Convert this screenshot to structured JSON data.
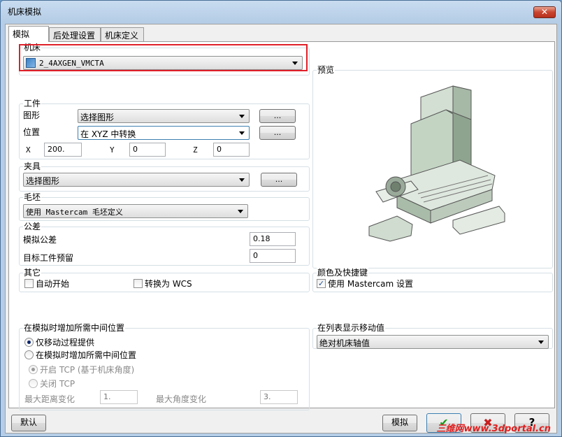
{
  "window": {
    "title": "机床模拟",
    "close_glyph": "✕"
  },
  "tabs": [
    {
      "label": "模拟"
    },
    {
      "label": "后处理设置"
    },
    {
      "label": "机床定义"
    }
  ],
  "machine": {
    "group_label": "机床",
    "value": "2_4AXGEN_VMCTA",
    "icon": "machine-icon"
  },
  "workpiece": {
    "group_label": "工件",
    "geometry_label": "图形",
    "geometry_value": "选择图形",
    "geometry_btn": "...",
    "position_label": "位置",
    "position_value": "在 XYZ 中转换",
    "position_btn": "...",
    "x_label": "X",
    "x_value": "200.",
    "y_label": "Y",
    "y_value": "0",
    "z_label": "Z",
    "z_value": "0"
  },
  "fixture": {
    "group_label": "夹具",
    "value": "选择图形",
    "btn": "..."
  },
  "stock": {
    "group_label": "毛坯",
    "value": "使用 Mastercam 毛坯定义"
  },
  "tolerance": {
    "group_label": "公差",
    "sim_label": "模拟公差",
    "sim_value": "0.18",
    "stock_label": "目标工件预留",
    "stock_value": "0"
  },
  "other": {
    "group_label": "其它",
    "auto_start": "自动开始",
    "convert_wcs": "转换为 WCS"
  },
  "preview": {
    "group_label": "预览"
  },
  "colors": {
    "group_label": "颜色及快捷键",
    "use_mastercam": "使用 Mastercam 设置"
  },
  "intermediate": {
    "group_label": "在模拟时增加所需中间位置",
    "opt1": "仅移动过程提供",
    "opt2": "在模拟时增加所需中间位置",
    "tcp_on": "开启 TCP (基于机床角度)",
    "tcp_off": "关闭 TCP",
    "max_dist_label": "最大距离变化",
    "max_dist_value": "1.",
    "max_angle_label": "最大角度变化",
    "max_angle_value": "3."
  },
  "list_display": {
    "group_label": "在列表显示移动值",
    "value": "绝对机床轴值"
  },
  "footer": {
    "default_btn": "默认",
    "simulate_btn": "模拟",
    "ok_glyph": "✔",
    "cancel_glyph": "✖",
    "help_glyph": "?"
  },
  "watermark": "三维网www.3dportal.cn",
  "accent": {
    "red_highlight": "#e0202a",
    "window_blue": "#b5cde6"
  }
}
